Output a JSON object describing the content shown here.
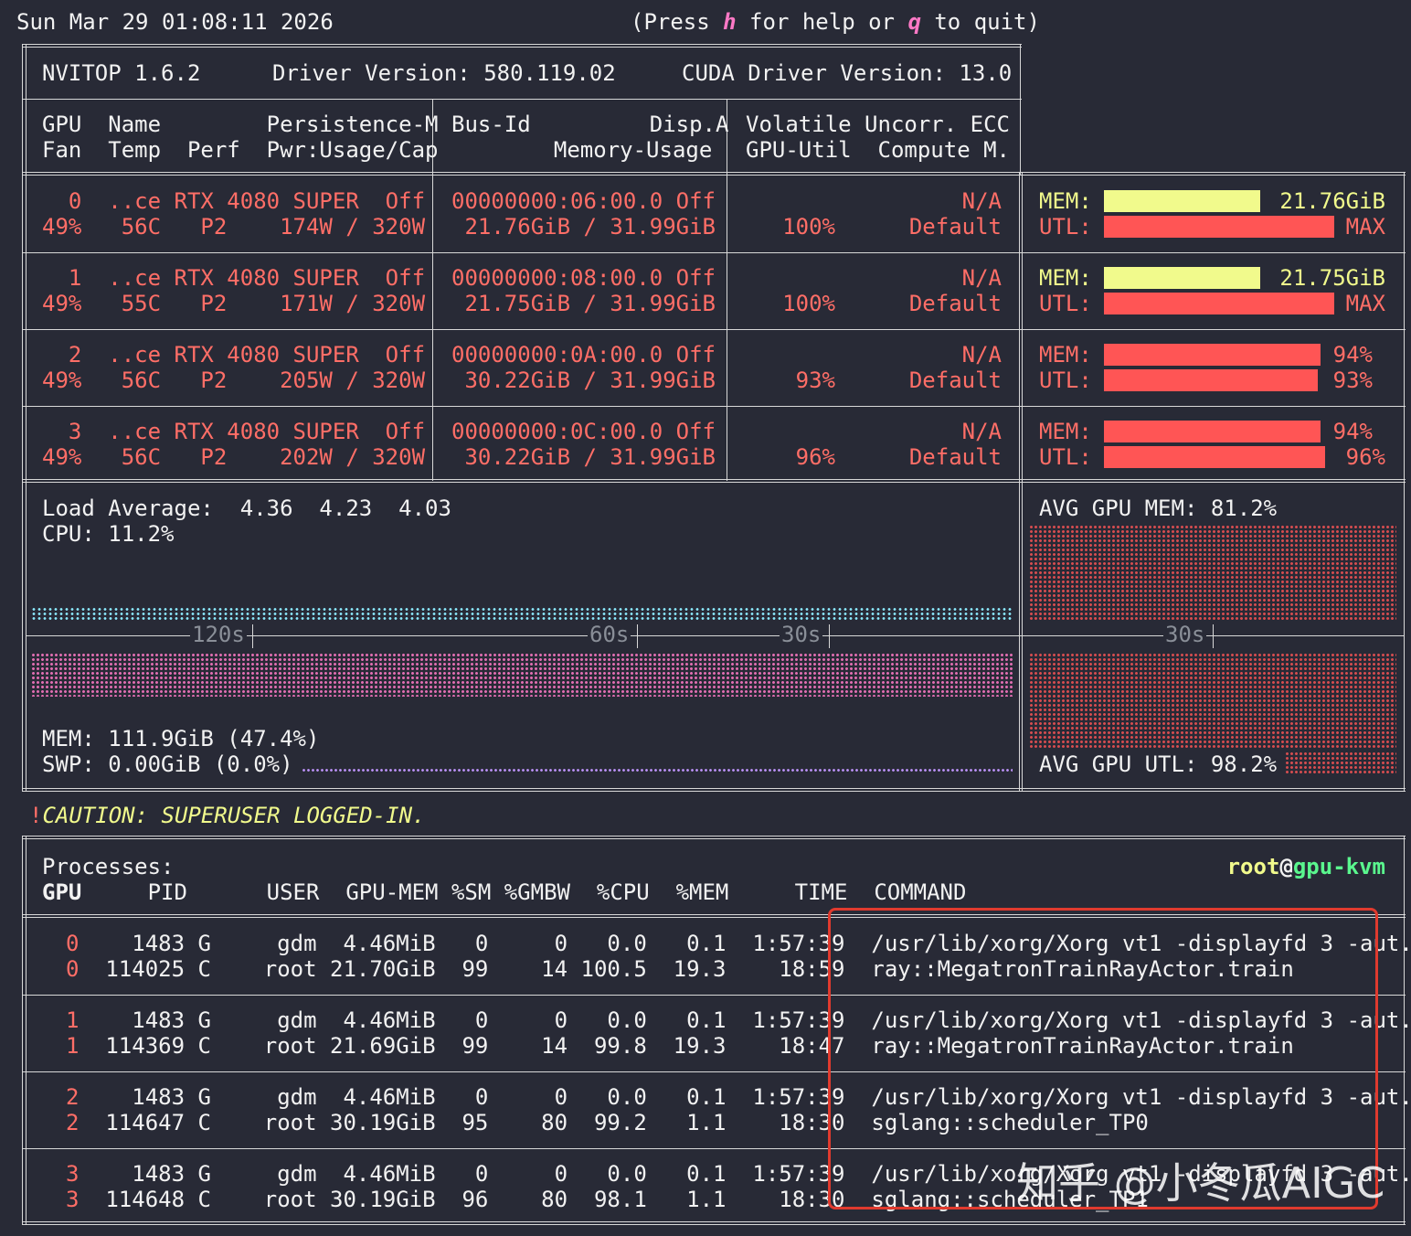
{
  "header": {
    "datetime": "Sun Mar 29 01:08:11 2026",
    "help_prefix": "(Press ",
    "help_key_h": "h",
    "help_mid": " for help or ",
    "help_key_q": "q",
    "help_suffix": " to quit)"
  },
  "info": {
    "nvitop": "NVITOP 1.6.2",
    "driver": "Driver Version: 580.119.02",
    "cuda": "CUDA Driver Version: 13.0"
  },
  "columns": {
    "c1_line1": "GPU  Name        Persistence-M",
    "c1_line2": "Fan  Temp  Perf  Pwr:Usage/Cap",
    "c2_line1": "Bus-Id         Disp.A",
    "c2_line2": "  Memory-Usage",
    "c3_line1": "Volatile Uncorr. ECC",
    "c3_line2": "GPU-Util  Compute M."
  },
  "gpus": [
    {
      "l1a": "  0  ..ce RTX 4080 SUPER  Off",
      "l2a": "49%   56C   P2    174W / 320W",
      "l1b": "00000000:06:00.0 Off",
      "l2b": " 21.76GiB / 31.99GiB",
      "l1c": "N/A",
      "util": "100%",
      "compute": "Default",
      "mem_label": "MEM:",
      "utl_label": "UTL:",
      "mem_value": "21.76GiB",
      "utl_value": "MAX",
      "mem_frac": 0.68,
      "utl_frac": 1.0,
      "mem_color": "yellow"
    },
    {
      "l1a": "  1  ..ce RTX 4080 SUPER  Off",
      "l2a": "49%   55C   P2    171W / 320W",
      "l1b": "00000000:08:00.0 Off",
      "l2b": " 21.75GiB / 31.99GiB",
      "l1c": "N/A",
      "util": "100%",
      "compute": "Default",
      "mem_label": "MEM:",
      "utl_label": "UTL:",
      "mem_value": "21.75GiB",
      "utl_value": "MAX",
      "mem_frac": 0.68,
      "utl_frac": 1.0,
      "mem_color": "yellow"
    },
    {
      "l1a": "  2  ..ce RTX 4080 SUPER  Off",
      "l2a": "49%   56C   P2    205W / 320W",
      "l1b": "00000000:0A:00.0 Off",
      "l2b": " 30.22GiB / 31.99GiB",
      "l1c": "N/A",
      "util": "93%",
      "compute": "Default",
      "mem_label": "MEM:",
      "utl_label": "UTL:",
      "mem_value": "94%",
      "utl_value": "93%",
      "mem_frac": 0.94,
      "utl_frac": 0.93,
      "mem_color": "red"
    },
    {
      "l1a": "  3  ..ce RTX 4080 SUPER  Off",
      "l2a": "49%   56C   P2    202W / 320W",
      "l1b": "00000000:0C:00.0 Off",
      "l2b": " 30.22GiB / 31.99GiB",
      "l1c": "N/A",
      "util": "96%",
      "compute": "Default",
      "mem_label": "MEM:",
      "utl_label": "UTL:",
      "mem_value": "94%",
      "utl_value": "96%",
      "mem_frac": 0.94,
      "utl_frac": 0.96,
      "mem_color": "red"
    }
  ],
  "host": {
    "load_average": "Load Average:  4.36  4.23  4.03",
    "cpu": "CPU: 11.2%",
    "mem": "MEM: 111.9GiB (47.4%)",
    "swp": "SWP: 0.00GiB (0.0%)",
    "avg_gpu_mem": "AVG GPU MEM: 81.2%",
    "avg_gpu_utl": "AVG GPU UTL: 98.2%",
    "ticks": [
      "120s",
      "60s",
      "30s",
      "30s"
    ]
  },
  "caution": {
    "mark": "!",
    "text": "CAUTION: SUPERUSER LOGGED-IN."
  },
  "processes": {
    "title": "Processes:",
    "user": "root",
    "at": "@",
    "host": "gpu-kvm",
    "headers": {
      "gpu": "GPU",
      "rest": "     PID      USER  GPU-MEM %SM %GMBW  %CPU  %MEM     TIME  COMMAND"
    },
    "rows": [
      {
        "gpu": "0",
        "rest": "    1483 G     gdm  4.46MiB   0     0   0.0   0.1  1:57:39  /usr/lib/xorg/Xorg vt1 -displayfd 3 -aut.."
      },
      {
        "gpu": "0",
        "rest": "  114025 C    root 21.70GiB  99    14 100.5  19.3    18:59  ray::MegatronTrainRayActor.train"
      },
      {
        "gpu": "1",
        "rest": "    1483 G     gdm  4.46MiB   0     0   0.0   0.1  1:57:39  /usr/lib/xorg/Xorg vt1 -displayfd 3 -aut.."
      },
      {
        "gpu": "1",
        "rest": "  114369 C    root 21.69GiB  99    14  99.8  19.3    18:47  ray::MegatronTrainRayActor.train"
      },
      {
        "gpu": "2",
        "rest": "    1483 G     gdm  4.46MiB   0     0   0.0   0.1  1:57:39  /usr/lib/xorg/Xorg vt1 -displayfd 3 -aut.."
      },
      {
        "gpu": "2",
        "rest": "  114647 C    root 30.19GiB  95    80  99.2   1.1    18:30  sglang::scheduler_TP0"
      },
      {
        "gpu": "3",
        "rest": "    1483 G     gdm  4.46MiB   0     0   0.0   0.1  1:57:39  /usr/lib/xorg/Xorg vt1 -displayfd 3 -aut.."
      },
      {
        "gpu": "3",
        "rest": "  114648 C    root 30.19GiB  96    80  98.1   1.1    18:30  sglang::scheduler_TP1"
      }
    ]
  },
  "watermark": "知乎 @小冬瓜AIGC",
  "colors": {
    "bg": "#282a36",
    "red": "#ff5555",
    "yellow": "#f1fa8c",
    "cyan": "#8be9fd",
    "pink": "#ff79c6",
    "purple": "#bd93f9"
  }
}
